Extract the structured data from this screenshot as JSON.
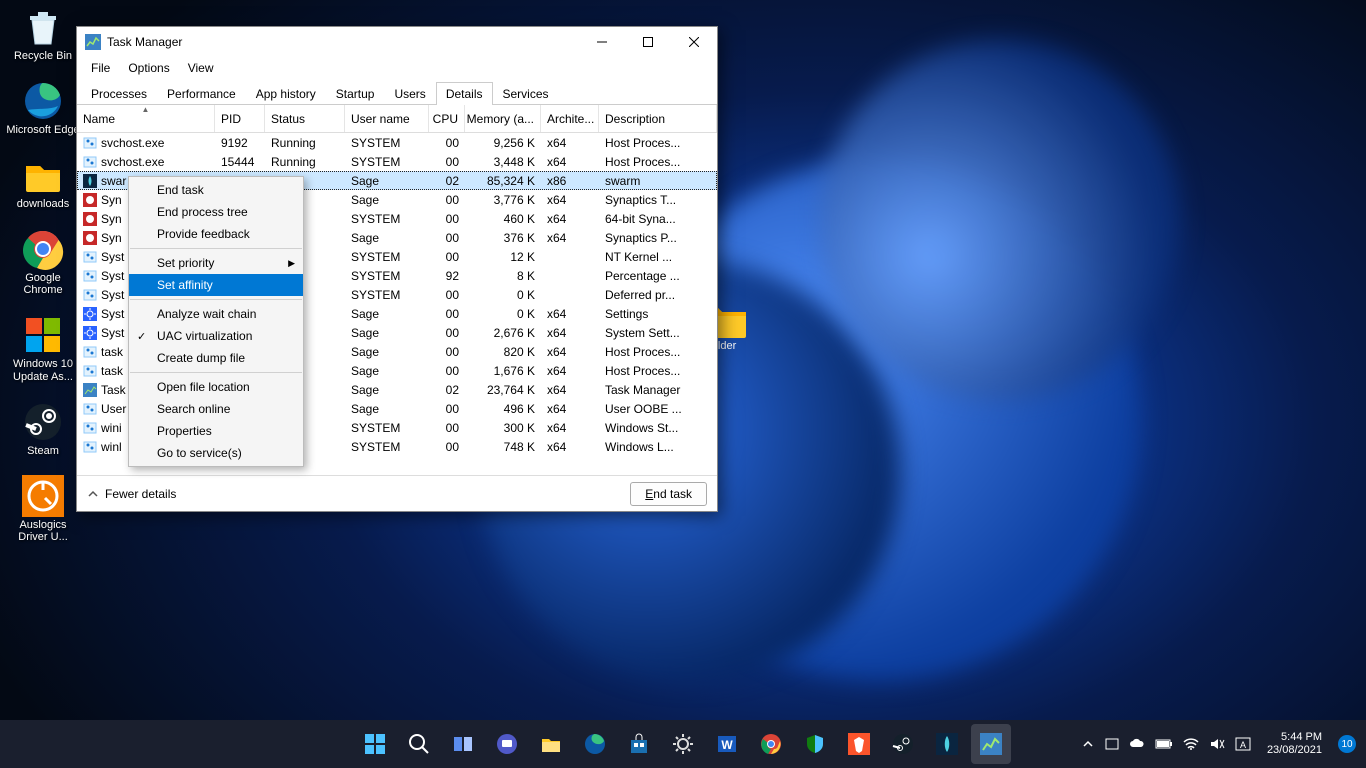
{
  "desktop": {
    "icons": [
      {
        "name": "recycle-bin",
        "label": "Recycle Bin"
      },
      {
        "name": "edge",
        "label": "Microsoft Edge"
      },
      {
        "name": "downloads",
        "label": "downloads"
      },
      {
        "name": "chrome",
        "label": "Google Chrome"
      },
      {
        "name": "win10-update",
        "label": "Windows 10 Update As..."
      },
      {
        "name": "steam",
        "label": "Steam"
      },
      {
        "name": "auslogics",
        "label": "Auslogics Driver U..."
      }
    ],
    "folder_right_label": "older"
  },
  "window": {
    "title": "Task Manager",
    "menu": [
      "File",
      "Options",
      "View"
    ],
    "tabs": [
      "Processes",
      "Performance",
      "App history",
      "Startup",
      "Users",
      "Details",
      "Services"
    ],
    "active_tab": "Details",
    "columns": [
      "Name",
      "PID",
      "Status",
      "User name",
      "CPU",
      "Memory (a...",
      "Archite...",
      "Description"
    ],
    "rows": [
      {
        "icon": "svc",
        "name": "svchost.exe",
        "pid": "9192",
        "status": "Running",
        "user": "SYSTEM",
        "cpu": "00",
        "mem": "9,256 K",
        "arch": "x64",
        "desc": "Host Proces..."
      },
      {
        "icon": "svc",
        "name": "svchost.exe",
        "pid": "15444",
        "status": "Running",
        "user": "SYSTEM",
        "cpu": "00",
        "mem": "3,448 K",
        "arch": "x64",
        "desc": "Host Proces..."
      },
      {
        "icon": "swarm",
        "name": "swar",
        "pid": "",
        "status": "g",
        "user": "Sage",
        "cpu": "02",
        "mem": "85,324 K",
        "arch": "x86",
        "desc": "swarm",
        "sel": true
      },
      {
        "icon": "syn",
        "name": "Syn",
        "pid": "",
        "status": "g",
        "user": "Sage",
        "cpu": "00",
        "mem": "3,776 K",
        "arch": "x64",
        "desc": "Synaptics T..."
      },
      {
        "icon": "syn",
        "name": "Syn",
        "pid": "",
        "status": "g",
        "user": "SYSTEM",
        "cpu": "00",
        "mem": "460 K",
        "arch": "x64",
        "desc": "64-bit Syna..."
      },
      {
        "icon": "syn",
        "name": "Syn",
        "pid": "",
        "status": "g",
        "user": "Sage",
        "cpu": "00",
        "mem": "376 K",
        "arch": "x64",
        "desc": "Synaptics P..."
      },
      {
        "icon": "svc",
        "name": "Syst",
        "pid": "",
        "status": "g",
        "user": "SYSTEM",
        "cpu": "00",
        "mem": "12 K",
        "arch": "",
        "desc": "NT Kernel ..."
      },
      {
        "icon": "svc",
        "name": "Syst",
        "pid": "",
        "status": "g",
        "user": "SYSTEM",
        "cpu": "92",
        "mem": "8 K",
        "arch": "",
        "desc": "Percentage ..."
      },
      {
        "icon": "svc",
        "name": "Syst",
        "pid": "",
        "status": "g",
        "user": "SYSTEM",
        "cpu": "00",
        "mem": "0 K",
        "arch": "",
        "desc": "Deferred pr..."
      },
      {
        "icon": "gear",
        "name": "Syst",
        "pid": "",
        "status": "ded",
        "user": "Sage",
        "cpu": "00",
        "mem": "0 K",
        "arch": "x64",
        "desc": "Settings"
      },
      {
        "icon": "gear",
        "name": "Syst",
        "pid": "",
        "status": "g",
        "user": "Sage",
        "cpu": "00",
        "mem": "2,676 K",
        "arch": "x64",
        "desc": "System Sett..."
      },
      {
        "icon": "svc",
        "name": "task",
        "pid": "",
        "status": "g",
        "user": "Sage",
        "cpu": "00",
        "mem": "820 K",
        "arch": "x64",
        "desc": "Host Proces..."
      },
      {
        "icon": "svc",
        "name": "task",
        "pid": "",
        "status": "g",
        "user": "Sage",
        "cpu": "00",
        "mem": "1,676 K",
        "arch": "x64",
        "desc": "Host Proces..."
      },
      {
        "icon": "tm",
        "name": "Task",
        "pid": "",
        "status": "g",
        "user": "Sage",
        "cpu": "02",
        "mem": "23,764 K",
        "arch": "x64",
        "desc": "Task Manager"
      },
      {
        "icon": "svc",
        "name": "User",
        "pid": "",
        "status": "g",
        "user": "Sage",
        "cpu": "00",
        "mem": "496 K",
        "arch": "x64",
        "desc": "User OOBE ..."
      },
      {
        "icon": "svc",
        "name": "wini",
        "pid": "",
        "status": "g",
        "user": "SYSTEM",
        "cpu": "00",
        "mem": "300 K",
        "arch": "x64",
        "desc": "Windows St..."
      },
      {
        "icon": "svc",
        "name": "winl",
        "pid": "",
        "status": "g",
        "user": "SYSTEM",
        "cpu": "00",
        "mem": "748 K",
        "arch": "x64",
        "desc": "Windows L..."
      }
    ],
    "footer": {
      "fewer": "Fewer details",
      "endtask": "End task"
    }
  },
  "context_menu": {
    "items": [
      {
        "label": "End task"
      },
      {
        "label": "End process tree"
      },
      {
        "label": "Provide feedback"
      },
      {
        "sep": true
      },
      {
        "label": "Set priority",
        "submenu": true
      },
      {
        "label": "Set affinity",
        "highlight": true
      },
      {
        "sep": true
      },
      {
        "label": "Analyze wait chain"
      },
      {
        "label": "UAC virtualization",
        "checked": true
      },
      {
        "label": "Create dump file"
      },
      {
        "sep": true
      },
      {
        "label": "Open file location"
      },
      {
        "label": "Search online"
      },
      {
        "label": "Properties"
      },
      {
        "label": "Go to service(s)"
      }
    ]
  },
  "taskbar": {
    "center": [
      "start",
      "search",
      "taskview",
      "chat",
      "explorer",
      "edge",
      "store",
      "settings",
      "word",
      "chrome",
      "security",
      "brave",
      "steam",
      "swarm",
      "taskmgr"
    ],
    "sys": [
      "chevron",
      "tablet",
      "cloud",
      "battery",
      "wifi",
      "volume",
      "ime"
    ],
    "time": "5:44 PM",
    "date": "23/08/2021",
    "badge": "10"
  }
}
